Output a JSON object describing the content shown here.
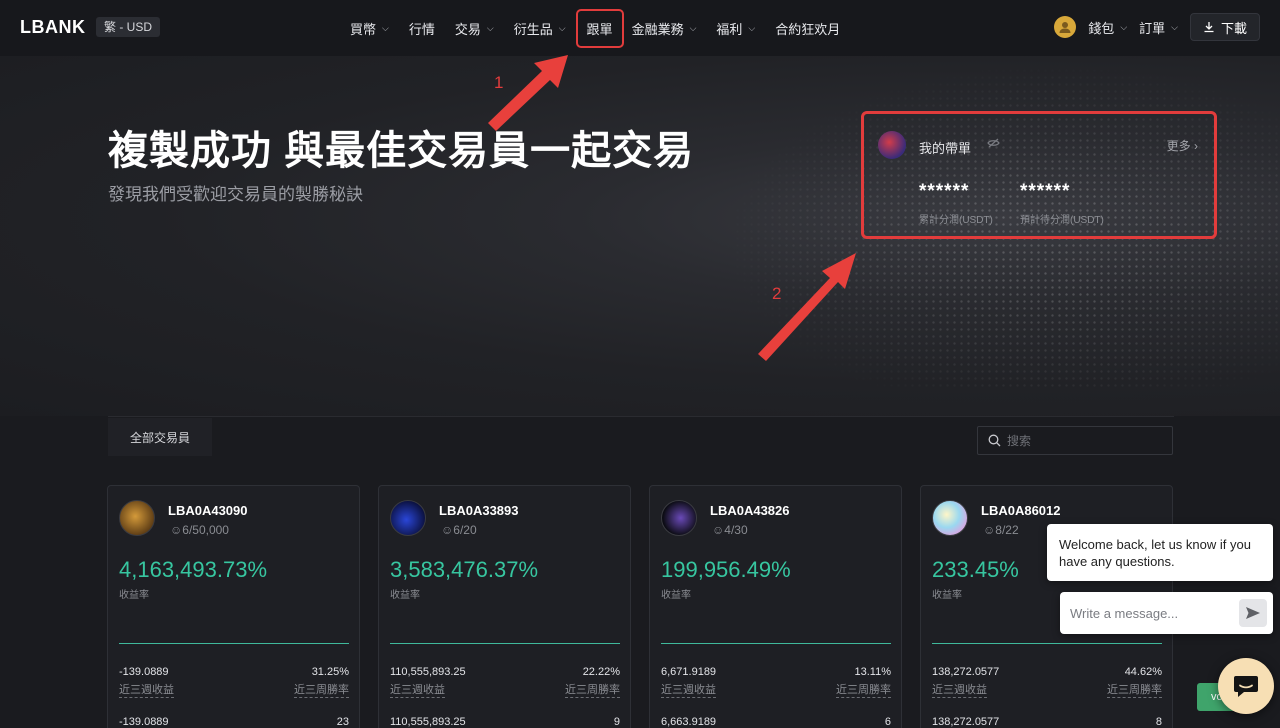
{
  "nav": {
    "logo": "LBANK",
    "locale": "繁 - USD",
    "items": [
      {
        "label": "買幣",
        "chevron": true
      },
      {
        "label": "行情",
        "chevron": false
      },
      {
        "label": "交易",
        "chevron": true
      },
      {
        "label": "衍生品",
        "chevron": true
      },
      {
        "label": "跟單",
        "chevron": false,
        "highlighted": true
      },
      {
        "label": "金融業務",
        "chevron": true
      },
      {
        "label": "福利",
        "chevron": true
      },
      {
        "label": "合約狂欢月",
        "chevron": false
      }
    ],
    "wallet": "錢包",
    "orders": "訂單",
    "download": "下載"
  },
  "hero": {
    "title": "複製成功 與最佳交易員一起交易",
    "subtitle": "發現我們受歡迎交易員的製勝秘訣"
  },
  "my_panel": {
    "title": "我的帶單",
    "more": "更多",
    "cumulative_value": "******",
    "cumulative_label": "累計分潤(USDT)",
    "expected_value": "******",
    "expected_label": "預計待分潤(USDT)"
  },
  "annotations": {
    "label_1": "1",
    "label_2": "2"
  },
  "filter": {
    "tab_all": "全部交易員",
    "search_placeholder": "搜索"
  },
  "cards": [
    {
      "name": "LBA0A43090",
      "followers": "6/50,000",
      "roi": "4,163,493.73%",
      "roi_label": "收益率",
      "pnl_3w": "-139.0889",
      "pnl_3w_label": "近三週收益",
      "winrate": "31.25%",
      "winrate_label": "近三周勝率",
      "row2_left": "-139.0889",
      "row2_right": "23",
      "avatar_color": "#b8862f"
    },
    {
      "name": "LBA0A33893",
      "followers": "6/20",
      "roi": "3,583,476.37%",
      "roi_label": "收益率",
      "pnl_3w": "110,555,893.25",
      "pnl_3w_label": "近三週收益",
      "winrate": "22.22%",
      "winrate_label": "近三周勝率",
      "row2_left": "110,555,893.25",
      "row2_right": "9",
      "avatar_color": "#1a2a8c"
    },
    {
      "name": "LBA0A43826",
      "followers": "4/30",
      "roi": "199,956.49%",
      "roi_label": "收益率",
      "pnl_3w": "6,671.9189",
      "pnl_3w_label": "近三週收益",
      "winrate": "13.11%",
      "winrate_label": "近三周勝率",
      "row2_left": "6,663.9189",
      "row2_right": "6",
      "avatar_color": "#3a2a6a"
    },
    {
      "name": "LBA0A86012",
      "followers": "8/22",
      "roi": "233.45%",
      "roi_label": "收益率",
      "pnl_3w": "138,272.0577",
      "pnl_3w_label": "近三週收益",
      "winrate": "44.62%",
      "winrate_label": "近三周勝率",
      "row2_left": "138,272.0577",
      "row2_right": "8",
      "avatar_color": "#e0c0e8"
    }
  ],
  "chat": {
    "welcome": "Welcome back, let us know if you have any questions.",
    "input_placeholder": "Write a message..."
  },
  "green_button": "vo"
}
